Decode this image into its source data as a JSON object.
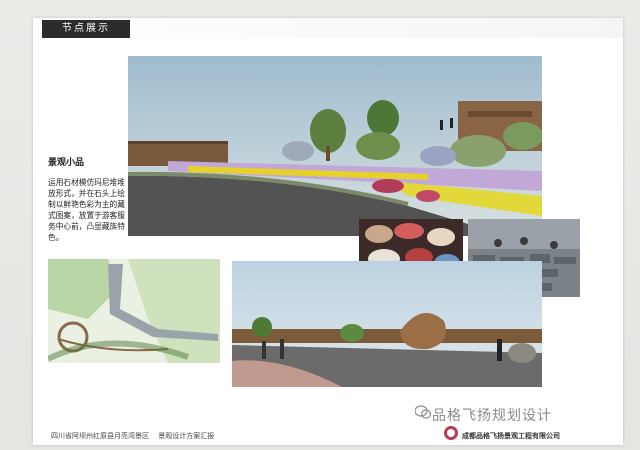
{
  "section": {
    "tag": "节点展示"
  },
  "feature": {
    "title": "景观小品",
    "description": "运用石材模仿玛尼堆堆放形式，并在石头上绘制以鲜艳色彩为主的藏式图案，放置于游客服务中心前，凸显藏族特色。"
  },
  "footer": {
    "left": "四川省阿坝州红原县月亮湾景区　 景观设计方案汇报",
    "company": "成都品格飞扬景观工程有限公司"
  },
  "watermark": {
    "text": "品格飞扬规划设计"
  },
  "colors": {
    "tag_bg": "#2c2c2c",
    "logo": "#b73d53",
    "watermark": "#8b8b8b"
  },
  "icons": [
    "wechat-icon",
    "company-logo-icon"
  ]
}
